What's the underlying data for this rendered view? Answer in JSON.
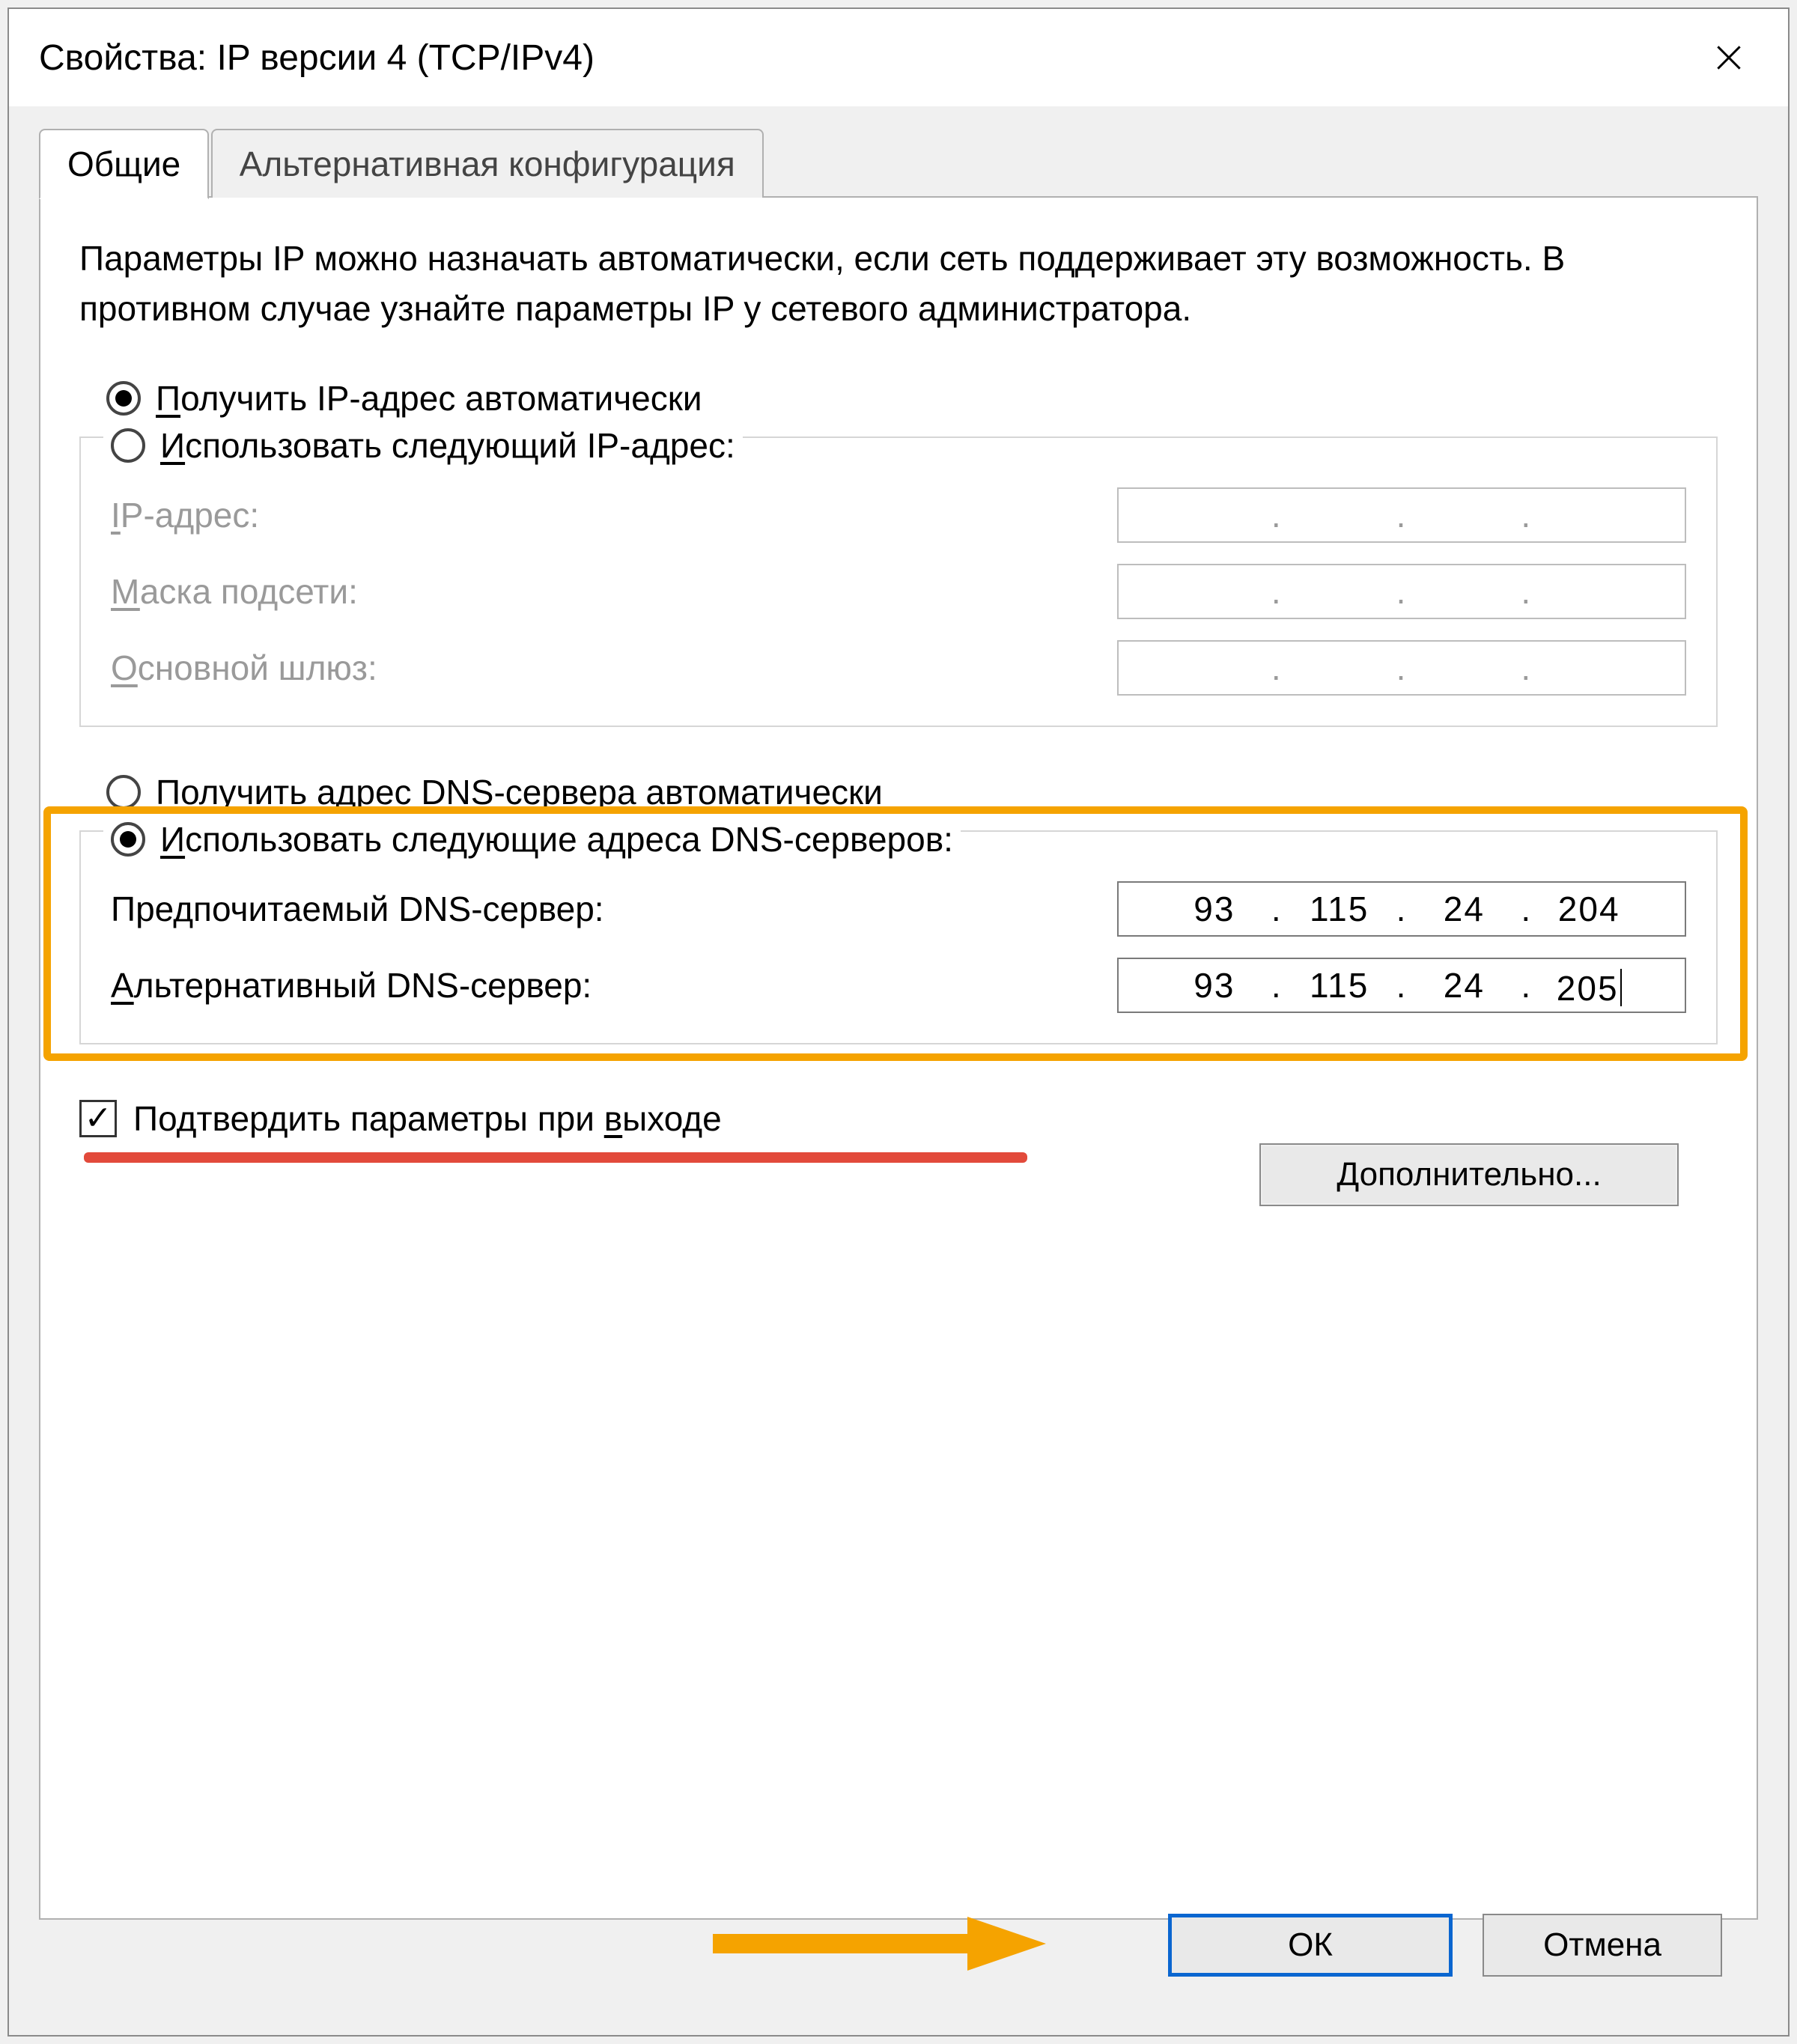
{
  "window": {
    "title": "Свойства: IP версии 4 (TCP/IPv4)"
  },
  "tabs": {
    "general": "Общие",
    "alternate": "Альтернативная конфигурация"
  },
  "description": "Параметры IP можно назначать автоматически, если сеть поддерживает эту возможность. В противном случае узнайте параметры IP у сетевого администратора.",
  "ip_section": {
    "auto_prefix": "П",
    "auto_suffix": "олучить IP-адрес автоматически",
    "manual_prefix": "И",
    "manual_suffix": "спользовать следующий IP-адрес:",
    "ip_label_prefix": "I",
    "ip_label_suffix": "P-адрес:",
    "mask_label_prefix": "М",
    "mask_label_suffix": "аска подсети:",
    "gw_label_prefix": "О",
    "gw_label_suffix": "сновной шлюз:"
  },
  "dns_section": {
    "auto_prefix": "П",
    "auto_suffix": "олучить адрес DNS-сервера автоматически",
    "manual_prefix": "И",
    "manual_suffix": "спользовать следующие адреса DNS-серверов:",
    "preferred_label": "Предпочитаемый DNS-сервер:",
    "alternate_prefix": "А",
    "alternate_suffix": "льтернативный DNS-сервер:",
    "preferred_value": {
      "o1": "93",
      "o2": "115",
      "o3": "24",
      "o4": "204"
    },
    "alternate_value": {
      "o1": "93",
      "o2": "115",
      "o3": "24",
      "o4": "205"
    }
  },
  "validate_checkbox": {
    "prefix": "Подтвердить параметры при ",
    "u": "в",
    "suffix": "ыходе"
  },
  "buttons": {
    "advanced_prefix": "Д",
    "advanced_suffix": "ополнительно...",
    "ok": "ОК",
    "cancel": "Отмена"
  },
  "dot": "."
}
